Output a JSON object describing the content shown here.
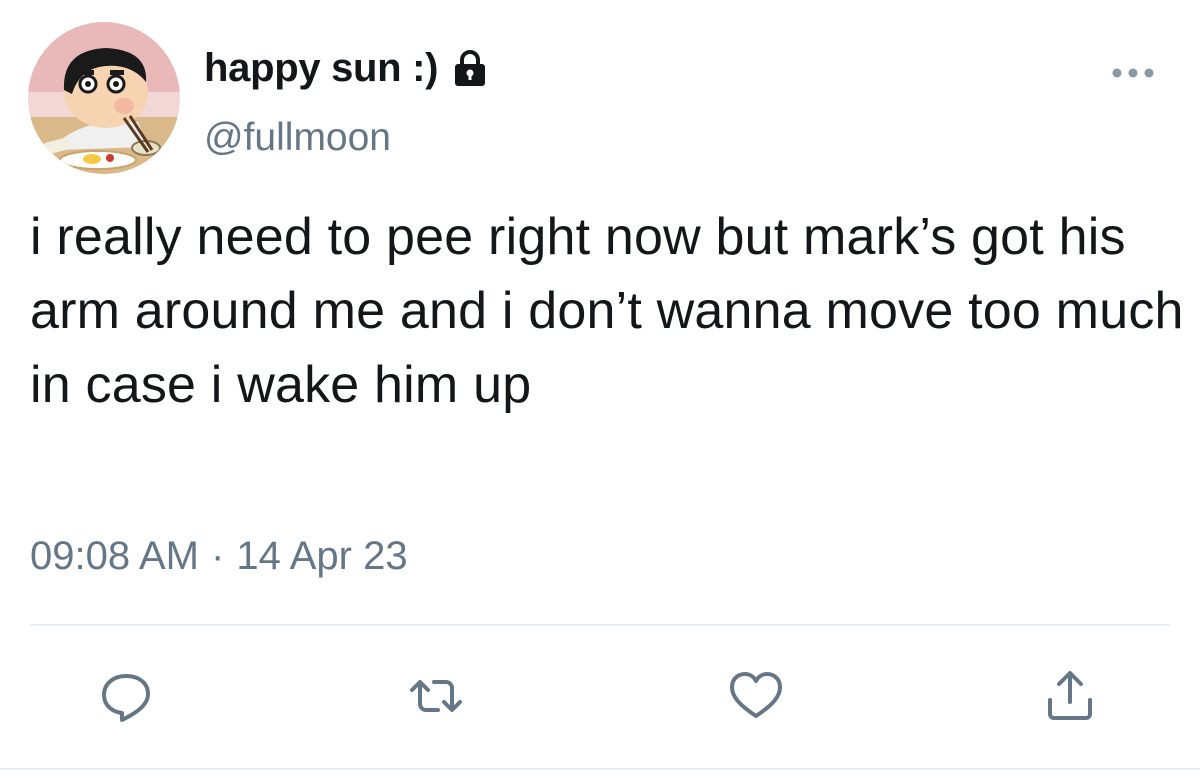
{
  "author": {
    "display_name": "happy sun :)",
    "username": "@fullmoon",
    "avatar_icon": "cartoon-avatar",
    "protected_icon": "lock-icon"
  },
  "tweet": {
    "text": "i really need to pee right now but mark’s got his arm around me and i don’t wanna move too much in case i wake him up",
    "time": "09:08 AM",
    "separator": "·",
    "date": "14 Apr 23"
  },
  "actions": {
    "reply_icon": "reply-icon",
    "retweet_icon": "retweet-icon",
    "like_icon": "heart-icon",
    "share_icon": "share-icon",
    "more_icon": "more-icon"
  },
  "colors": {
    "text_primary": "#14171a",
    "text_secondary": "#657786",
    "divider": "#e6ecf0"
  }
}
